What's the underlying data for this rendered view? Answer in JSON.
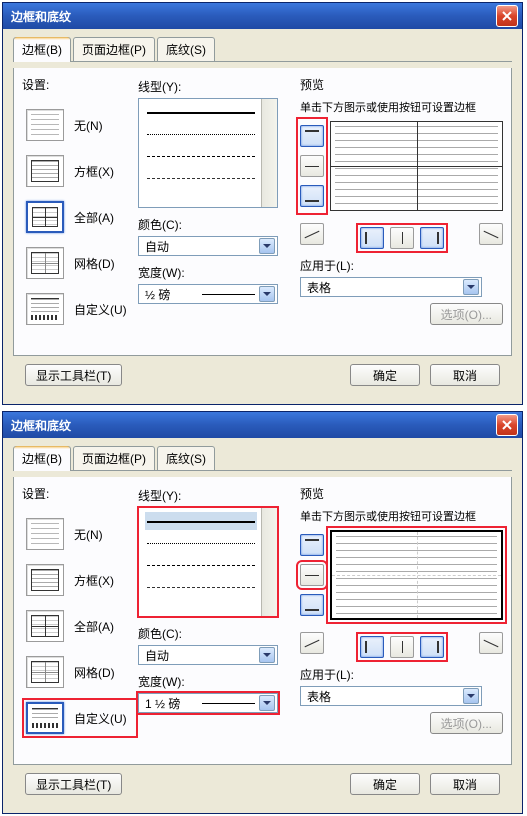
{
  "dialog_title": "边框和底纹",
  "tabs": {
    "borders": "边框(B)",
    "page_borders": "页面边框(P)",
    "shading": "底纹(S)"
  },
  "settings_label": "设置:",
  "setting_opts": {
    "none": "无(N)",
    "box": "方框(X)",
    "all": "全部(A)",
    "grid": "网格(D)",
    "custom": "自定义(U)"
  },
  "line_type_label": "线型(Y):",
  "color_label": "颜色(C):",
  "color_value": "自动",
  "width_label": "宽度(W):",
  "preview_label": "预览",
  "preview_help": "单击下方图示或使用按钮可设置边框",
  "apply_to_label": "应用于(L):",
  "apply_to_value": "表格",
  "options_btn": "选项(O)...",
  "show_toolbar_btn": "显示工具栏(T)",
  "ok_btn": "确定",
  "cancel_btn": "取消",
  "dialogs": [
    {
      "selected_setting": "all",
      "width_value": "½ 磅",
      "highlight_line_list": false,
      "highlight_first_line": false,
      "highlight_width": false,
      "highlight_side_btns": true,
      "highlight_bottom_btns": true,
      "highlight_preview": false,
      "preview_thick": false,
      "highlight_custom_opt": false,
      "highlight_mid_btn": false
    },
    {
      "selected_setting": "custom",
      "width_value": "1 ½ 磅",
      "highlight_line_list": true,
      "highlight_first_line": true,
      "highlight_width": true,
      "highlight_side_btns": false,
      "highlight_bottom_btns": true,
      "highlight_preview": true,
      "preview_thick": true,
      "highlight_custom_opt": true,
      "highlight_mid_btn": true
    }
  ]
}
